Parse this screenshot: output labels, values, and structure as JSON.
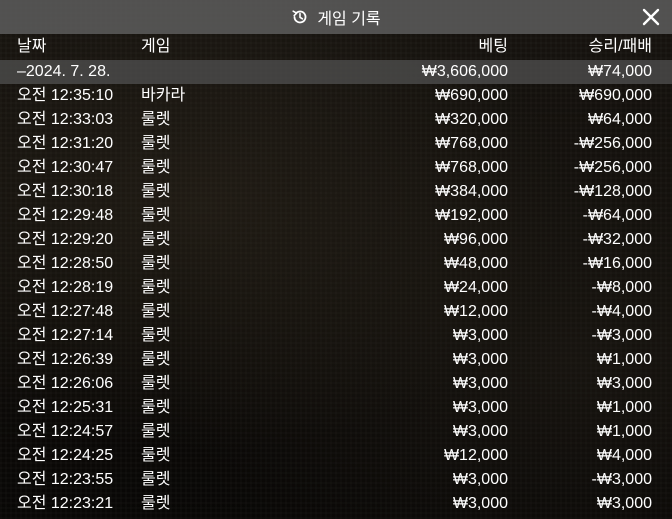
{
  "title": "게임 기록",
  "header": {
    "date": "날짜",
    "game": "게임",
    "bet": "베팅",
    "win_loss": "승리/패배"
  },
  "summary": {
    "date": "–2024. 7. 28.",
    "bet": "₩3,606,000",
    "win_loss": "₩74,000"
  },
  "rows": [
    {
      "time": "오전 12:35:10",
      "game": "바카라",
      "bet": "₩690,000",
      "result": "₩690,000"
    },
    {
      "time": "오전 12:33:03",
      "game": "룰렛",
      "bet": "₩320,000",
      "result": "₩64,000"
    },
    {
      "time": "오전 12:31:20",
      "game": "룰렛",
      "bet": "₩768,000",
      "result": "-₩256,000"
    },
    {
      "time": "오전 12:30:47",
      "game": "룰렛",
      "bet": "₩768,000",
      "result": "-₩256,000"
    },
    {
      "time": "오전 12:30:18",
      "game": "룰렛",
      "bet": "₩384,000",
      "result": "-₩128,000"
    },
    {
      "time": "오전 12:29:48",
      "game": "룰렛",
      "bet": "₩192,000",
      "result": "-₩64,000"
    },
    {
      "time": "오전 12:29:20",
      "game": "룰렛",
      "bet": "₩96,000",
      "result": "-₩32,000"
    },
    {
      "time": "오전 12:28:50",
      "game": "룰렛",
      "bet": "₩48,000",
      "result": "-₩16,000"
    },
    {
      "time": "오전 12:28:19",
      "game": "룰렛",
      "bet": "₩24,000",
      "result": "-₩8,000"
    },
    {
      "time": "오전 12:27:48",
      "game": "룰렛",
      "bet": "₩12,000",
      "result": "-₩4,000"
    },
    {
      "time": "오전 12:27:14",
      "game": "룰렛",
      "bet": "₩3,000",
      "result": "-₩3,000"
    },
    {
      "time": "오전 12:26:39",
      "game": "룰렛",
      "bet": "₩3,000",
      "result": "₩1,000"
    },
    {
      "time": "오전 12:26:06",
      "game": "룰렛",
      "bet": "₩3,000",
      "result": "₩3,000"
    },
    {
      "time": "오전 12:25:31",
      "game": "룰렛",
      "bet": "₩3,000",
      "result": "₩1,000"
    },
    {
      "time": "오전 12:24:57",
      "game": "룰렛",
      "bet": "₩3,000",
      "result": "₩1,000"
    },
    {
      "time": "오전 12:24:25",
      "game": "룰렛",
      "bet": "₩12,000",
      "result": "₩4,000"
    },
    {
      "time": "오전 12:23:55",
      "game": "룰렛",
      "bet": "₩3,000",
      "result": "-₩3,000"
    },
    {
      "time": "오전 12:23:21",
      "game": "룰렛",
      "bet": "₩3,000",
      "result": "₩3,000"
    }
  ],
  "icons": {
    "title": "history-icon",
    "close": "close-icon"
  },
  "colors": {
    "titlebar": "#5f5f5f",
    "text": "#ffffff"
  }
}
